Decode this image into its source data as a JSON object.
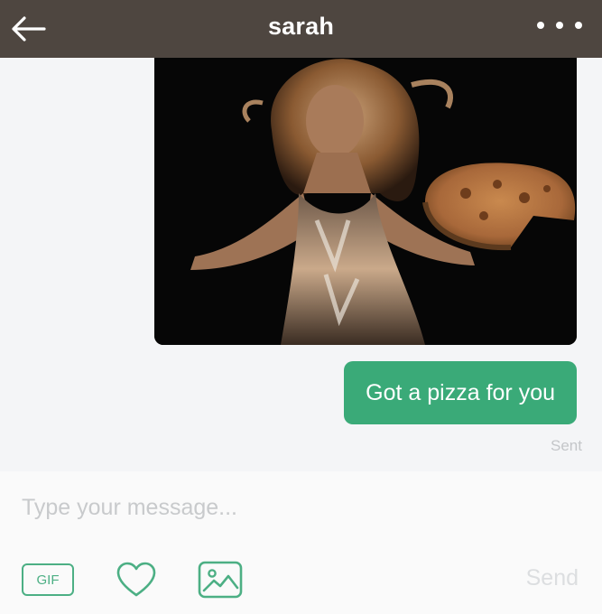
{
  "header": {
    "title": "sarah",
    "back_icon": "arrow-left-icon",
    "more_icon": "more-horizontal-icon"
  },
  "conversation": {
    "messages": [
      {
        "type": "gif",
        "direction": "outgoing",
        "description": ""
      },
      {
        "type": "text",
        "direction": "outgoing",
        "text": "Got a pizza for you"
      }
    ],
    "status": "Sent"
  },
  "composer": {
    "placeholder": "Type your message...",
    "gif_label": "GIF",
    "heart_icon": "heart-icon",
    "photo_icon": "image-icon",
    "send_label": "Send"
  },
  "colors": {
    "header_bg": "#4e4640",
    "accent_green": "#3aaa78",
    "icon_green": "#4caf84",
    "muted_text": "#c4c6c9"
  }
}
